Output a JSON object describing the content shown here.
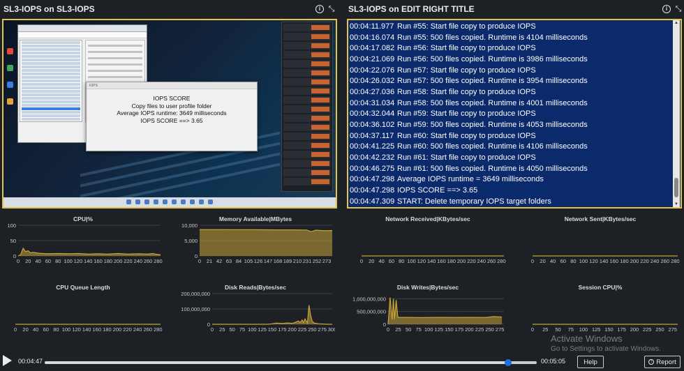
{
  "left_panel": {
    "title": "SL3-IOPS on SL3-IOPS"
  },
  "right_panel": {
    "title": "SL3-IOPS on EDIT RIGHT TITLE"
  },
  "dialog": {
    "window_title": "IOPS",
    "lines": [
      "IOPS SCORE",
      "Copy files to user profile folder",
      "Average IOPS runtime: 3649 milliseconds",
      "IOPS SCORE ==> 3.65"
    ]
  },
  "log": [
    {
      "time": "00:04:11.977",
      "msg": "Run #55: Start file copy to produce IOPS"
    },
    {
      "time": "00:04:16.074",
      "msg": "Run #55: 500 files copied. Runtime is 4104 milliseconds"
    },
    {
      "time": "00:04:17.082",
      "msg": "Run #56: Start file copy to produce IOPS"
    },
    {
      "time": "00:04:21.069",
      "msg": "Run #56: 500 files copied. Runtime is 3986 milliseconds"
    },
    {
      "time": "00:04:22.076",
      "msg": "Run #57: Start file copy to produce IOPS"
    },
    {
      "time": "00:04:26.032",
      "msg": "Run #57: 500 files copied. Runtime is 3954 milliseconds"
    },
    {
      "time": "00:04:27.036",
      "msg": "Run #58: Start file copy to produce IOPS"
    },
    {
      "time": "00:04:31.034",
      "msg": "Run #58: 500 files copied. Runtime is 4001 milliseconds"
    },
    {
      "time": "00:04:32.044",
      "msg": "Run #59: Start file copy to produce IOPS"
    },
    {
      "time": "00:04:36.102",
      "msg": "Run #59: 500 files copied. Runtime is 4053 milliseconds"
    },
    {
      "time": "00:04:37.117",
      "msg": "Run #60: Start file copy to produce IOPS"
    },
    {
      "time": "00:04:41.225",
      "msg": "Run #60: 500 files copied. Runtime is 4106 milliseconds"
    },
    {
      "time": "00:04:42.232",
      "msg": "Run #61: Start file copy to produce IOPS"
    },
    {
      "time": "00:04:46.275",
      "msg": "Run #61: 500 files copied. Runtime is 4050 milliseconds"
    },
    {
      "time": "00:04:47.298",
      "msg": "Average IOPS runtime = 3649 milliseconds"
    },
    {
      "time": "00:04:47.298",
      "msg": "IOPS SCORE ==> 3.65"
    },
    {
      "time": "00:04:47.309",
      "msg": "START: Delete temporary IOPS target folders"
    }
  ],
  "colors": {
    "accent": "#e6c34a",
    "series": "#c9a33a",
    "log_bg": "#0b2a6b",
    "seek": "#1e6fe0"
  },
  "player": {
    "current_time": "00:04:47",
    "total_time": "00:05:05",
    "progress_fraction": 0.9418,
    "help_label": "Help",
    "report_label": "Report"
  },
  "watermark": {
    "line1": "Activate Windows",
    "line2": "Go to Settings to activate Windows."
  },
  "chart_data": [
    {
      "type": "area",
      "title": "CPU|%",
      "x_ticks": [
        0,
        20,
        40,
        60,
        80,
        100,
        120,
        140,
        160,
        180,
        200,
        220,
        240,
        260,
        280
      ],
      "y_ticks": [
        "100",
        "50",
        "0"
      ],
      "ylim": [
        0,
        100
      ],
      "xlim": [
        0,
        285
      ],
      "x": [
        0,
        5,
        10,
        15,
        20,
        25,
        30,
        40,
        50,
        60,
        80,
        100,
        120,
        140,
        160,
        180,
        200,
        220,
        240,
        260,
        270,
        275,
        280,
        285
      ],
      "values": [
        0,
        4,
        25,
        14,
        17,
        10,
        12,
        9,
        8,
        7,
        8,
        7,
        8,
        6,
        7,
        6,
        8,
        6,
        7,
        6,
        8,
        6,
        5,
        4
      ]
    },
    {
      "type": "area",
      "title": "Memory Available|MBytes",
      "x_ticks": [
        0,
        21,
        42,
        63,
        84,
        105,
        126,
        147,
        168,
        189,
        210,
        231,
        252,
        273
      ],
      "y_ticks": [
        "10,000",
        "5,000",
        "0"
      ],
      "ylim": [
        0,
        10000
      ],
      "xlim": [
        0,
        285
      ],
      "x": [
        0,
        40,
        80,
        120,
        160,
        200,
        230,
        240,
        250,
        260,
        270,
        285
      ],
      "values": [
        8600,
        8600,
        8550,
        8550,
        8500,
        8500,
        8450,
        7900,
        8400,
        8300,
        8200,
        8300
      ]
    },
    {
      "type": "line",
      "title": "Network Received|KBytes/sec",
      "x_ticks": [
        0,
        20,
        40,
        60,
        80,
        100,
        120,
        140,
        160,
        180,
        200,
        220,
        240,
        260,
        280
      ],
      "y_ticks": [],
      "ylim": [
        0,
        1
      ],
      "xlim": [
        0,
        285
      ],
      "x": [
        0,
        285
      ],
      "values": [
        0,
        0
      ]
    },
    {
      "type": "line",
      "title": "Network Sent|KBytes/sec",
      "x_ticks": [
        0,
        20,
        40,
        60,
        80,
        100,
        120,
        140,
        160,
        180,
        200,
        220,
        240,
        260,
        280
      ],
      "y_ticks": [],
      "ylim": [
        0,
        1
      ],
      "xlim": [
        0,
        285
      ],
      "x": [
        0,
        285
      ],
      "values": [
        0,
        0
      ]
    },
    {
      "type": "line",
      "title": "CPU Queue Length",
      "x_ticks": [
        0,
        20,
        40,
        60,
        80,
        100,
        120,
        140,
        160,
        180,
        200,
        220,
        240,
        260,
        280
      ],
      "y_ticks": [],
      "ylim": [
        0,
        1
      ],
      "xlim": [
        0,
        285
      ],
      "x": [
        0,
        285
      ],
      "values": [
        0,
        0
      ]
    },
    {
      "type": "area",
      "title": "Disk Reads|Bytes/sec",
      "x_ticks": [
        0,
        25,
        50,
        75,
        100,
        125,
        150,
        175,
        200,
        225,
        250,
        275,
        300
      ],
      "y_ticks": [
        "200,000,000",
        "100,000,000",
        "0"
      ],
      "ylim": [
        0,
        200000000
      ],
      "xlim": [
        0,
        300
      ],
      "x": [
        0,
        140,
        150,
        160,
        175,
        190,
        200,
        210,
        215,
        220,
        225,
        228,
        232,
        238,
        242,
        246,
        250,
        255,
        265,
        275,
        290,
        300
      ],
      "values": [
        0,
        0,
        3000000,
        8000000,
        5000000,
        9000000,
        6000000,
        15000000,
        22000000,
        12000000,
        28000000,
        10000000,
        35000000,
        8000000,
        125000000,
        60000000,
        20000000,
        8000000,
        3000000,
        2000000,
        0,
        0
      ]
    },
    {
      "type": "area",
      "title": "Disk Writes|Bytes/sec",
      "x_ticks": [
        0,
        25,
        50,
        75,
        100,
        125,
        150,
        175,
        200,
        225,
        250,
        275
      ],
      "y_ticks": [
        "1,000,000,000",
        "500,000,000",
        "0"
      ],
      "ylim": [
        0,
        1200000000
      ],
      "xlim": [
        0,
        285
      ],
      "x": [
        0,
        5,
        10,
        13,
        16,
        20,
        24,
        40,
        80,
        120,
        160,
        200,
        240,
        260,
        275,
        280
      ],
      "values": [
        0,
        1050000000,
        180000000,
        1000000000,
        200000000,
        950000000,
        270000000,
        270000000,
        265000000,
        270000000,
        268000000,
        270000000,
        266000000,
        300000000,
        290000000,
        280000000
      ]
    },
    {
      "type": "line",
      "title": "Session CPU|%",
      "x_ticks": [
        0,
        25,
        50,
        75,
        100,
        125,
        150,
        175,
        200,
        225,
        250,
        275
      ],
      "y_ticks": [],
      "ylim": [
        0,
        1
      ],
      "xlim": [
        0,
        285
      ],
      "x": [
        0,
        285
      ],
      "values": [
        0,
        0
      ]
    }
  ]
}
